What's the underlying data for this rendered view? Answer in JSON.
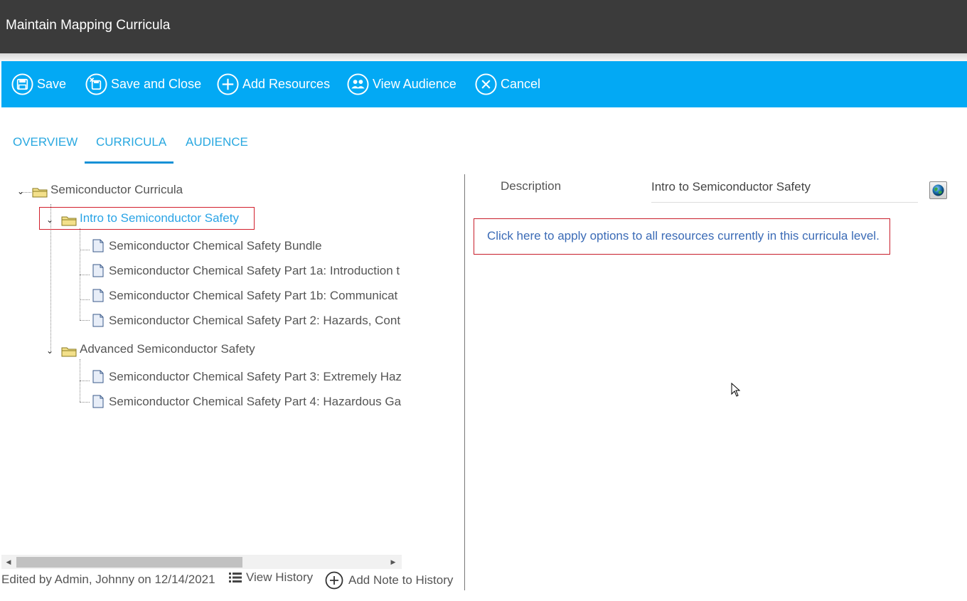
{
  "window": {
    "title": "Maintain Mapping Curricula"
  },
  "toolbar": {
    "save": "Save",
    "save_close": "Save and Close",
    "add_resources": "Add Resources",
    "view_audience": "View Audience",
    "cancel": "Cancel"
  },
  "tabs": {
    "overview": "OVERVIEW",
    "curricula": "CURRICULA",
    "audience": "AUDIENCE",
    "active": "CURRICULA"
  },
  "tree": {
    "root": "Semiconductor Curricula",
    "groups": [
      {
        "label": "Intro to Semiconductor Safety",
        "selected": true,
        "items": [
          "Semiconductor Chemical Safety Bundle",
          "Semiconductor Chemical Safety Part 1a: Introduction t",
          "Semiconductor Chemical Safety Part 1b: Communicat",
          "Semiconductor Chemical Safety Part 2: Hazards, Cont"
        ]
      },
      {
        "label": "Advanced Semiconductor Safety",
        "selected": false,
        "items": [
          "Semiconductor Chemical Safety Part 3: Extremely Haz",
          "Semiconductor Chemical Safety Part 4: Hazardous Ga"
        ]
      }
    ]
  },
  "footer": {
    "edited": "Edited by Admin, Johnny on 12/14/2021",
    "view_history": "View History",
    "add_note": "Add Note to History"
  },
  "details": {
    "description_label": "Description",
    "description_value": "Intro to Semiconductor Safety",
    "apply_link": "Click here to apply options to all resources currently in this curricula level."
  },
  "colors": {
    "titlebar": "#3b3b3b",
    "toolbar": "#03a9f4",
    "tab_active": "#29a8e0",
    "highlight_box": "#d21f2c",
    "link": "#3b6bb6"
  },
  "icons": [
    "save-icon",
    "save-close-icon",
    "add-circle-icon",
    "audience-icon",
    "cancel-icon",
    "folder-icon",
    "document-icon",
    "list-icon",
    "globe-icon"
  ]
}
